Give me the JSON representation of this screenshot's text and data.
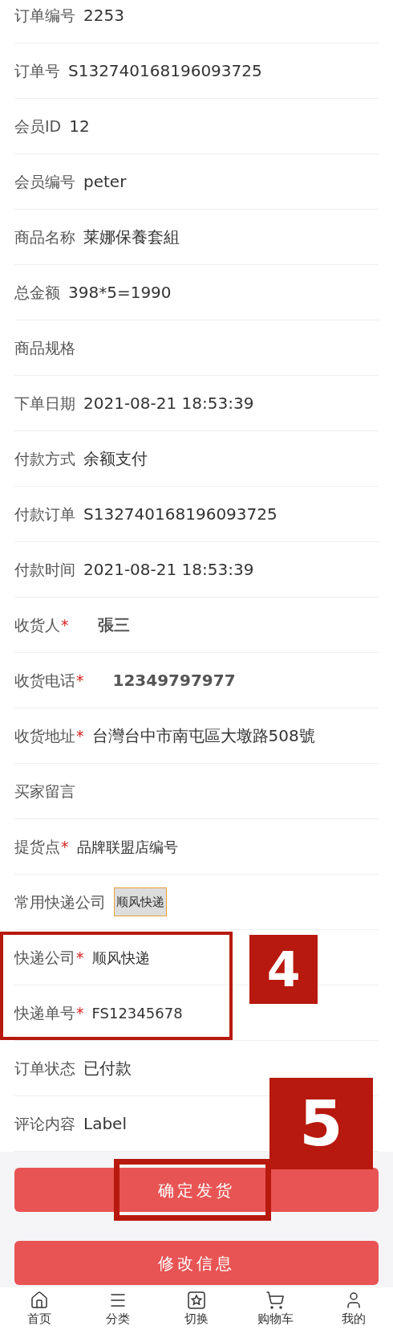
{
  "fields": [
    {
      "label": "订单编号",
      "value": "2253",
      "kind": "text"
    },
    {
      "label": "订单号",
      "value": "S132740168196093725",
      "kind": "text"
    },
    {
      "label": "会员ID",
      "value": "12",
      "kind": "text"
    },
    {
      "label": "会员编号",
      "value": "peter",
      "kind": "text"
    },
    {
      "label": "商品名称",
      "value": "莱娜保養套組",
      "kind": "text"
    },
    {
      "label": "总金额",
      "value": "398*5=1990",
      "kind": "text"
    },
    {
      "label": "商品规格"
    },
    {
      "label": "下单日期",
      "value": "2021-08-21 18:53:39",
      "kind": "text"
    },
    {
      "label": "付款方式",
      "value": "余额支付",
      "kind": "text"
    },
    {
      "label": "付款订单",
      "value": "S132740168196093725",
      "kind": "text"
    },
    {
      "label": "付款时间",
      "value": "2021-08-21 18:53:39",
      "kind": "text"
    },
    {
      "label": "收货人",
      "mark": "*",
      "value": "張三",
      "kind": "bold"
    },
    {
      "label": "收货电话",
      "mark": "*",
      "value": "12349797977",
      "kind": "bold"
    },
    {
      "label": "收货地址",
      "mark": "*",
      "value": "台灣台中市南屯區大墩路508號",
      "kind": "text"
    },
    {
      "label": "买家留言"
    },
    {
      "label": "提货点",
      "mark": "*",
      "value": "品牌联盟店编号",
      "kind": "small"
    },
    {
      "label": "常用快递公司",
      "value": "顺风快递",
      "kind": "chip"
    },
    {
      "label": "快递公司",
      "mark": "*",
      "value": "顺风快递",
      "kind": "small"
    },
    {
      "label": "快递单号",
      "mark": "*",
      "value": "FS12345678",
      "kind": "small"
    },
    {
      "label": "订单状态",
      "value": "已付款",
      "kind": "text"
    },
    {
      "label": "评论内容",
      "value": "Label",
      "kind": "text"
    }
  ],
  "buttons": [
    "确定发货",
    "修改信息"
  ],
  "annotations": [
    {
      "text": "4"
    },
    {
      "text": "5"
    }
  ],
  "nav": [
    {
      "label": "首页"
    },
    {
      "label": "分类"
    },
    {
      "label": "切换"
    },
    {
      "label": "购物车"
    },
    {
      "label": "我的"
    }
  ]
}
